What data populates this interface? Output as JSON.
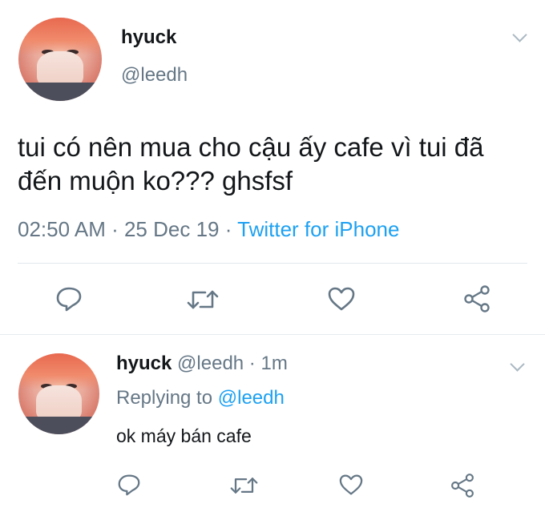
{
  "tweet": {
    "name": "hyuck",
    "handle": "@leedh",
    "text": "tui có nên mua cho cậu ấy cafe vì tui đã đến muộn ko??? ghsfsf",
    "time": "02:50 AM",
    "sep1": " · ",
    "date": "25 Dec 19",
    "sep2": " · ",
    "source": "Twitter for iPhone",
    "actions": [
      "reply-icon",
      "retweet-icon",
      "like-icon",
      "share-icon"
    ]
  },
  "reply": {
    "name": "hyuck",
    "handle": "@leedh",
    "sep": " · ",
    "age": "1m",
    "replying_prefix": "Replying to ",
    "replying_to": "@leedh",
    "text": "ok máy bán cafe",
    "actions": [
      "reply-icon",
      "retweet-icon",
      "like-icon",
      "share-icon"
    ]
  },
  "colors": {
    "text": "#14171a",
    "secondary": "#657786",
    "accent": "#1da1f2",
    "divider": "#e1e8ed"
  }
}
